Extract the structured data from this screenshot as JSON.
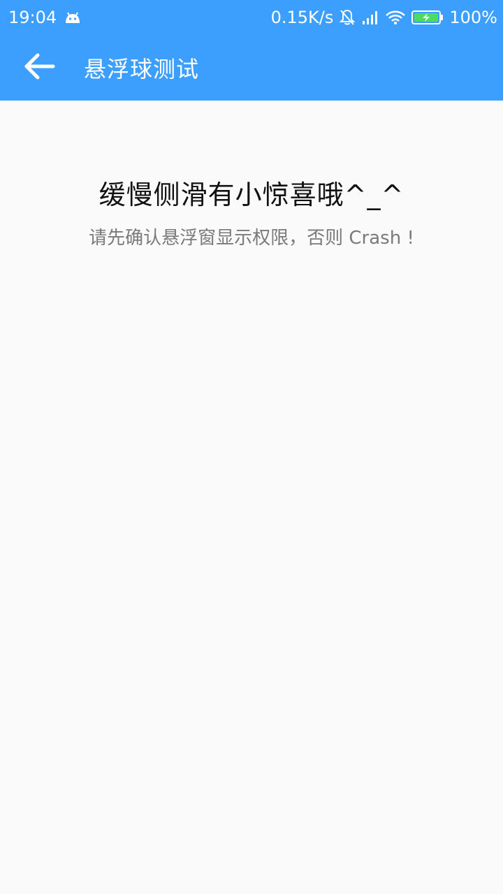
{
  "status_bar": {
    "time": "19:04",
    "net_speed": "0.15K/s",
    "battery": "100%",
    "icons": [
      "android-icon",
      "bell-off-icon",
      "signal-icon",
      "wifi-icon",
      "battery-charging-icon"
    ]
  },
  "app_bar": {
    "back_icon": "arrow-left-icon",
    "title": "悬浮球测试"
  },
  "main": {
    "headline": "缓慢侧滑有小惊喜哦^_^",
    "subline": "请先确认悬浮窗显示权限，否则 Crash !"
  },
  "colors": {
    "primary": "#3d9ffd",
    "background": "#fafafa",
    "headline": "#111111",
    "subline": "#7a7a7a",
    "battery_fill": "#4cd964"
  }
}
